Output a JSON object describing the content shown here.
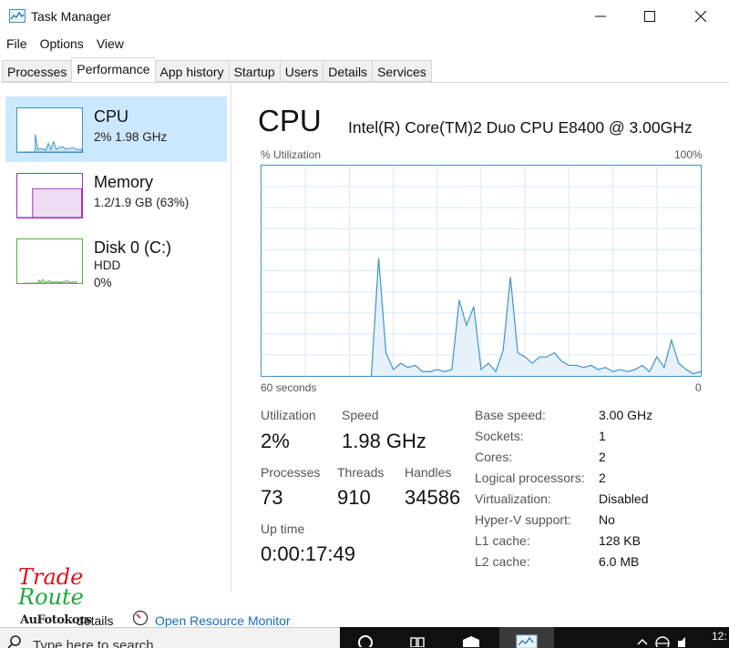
{
  "window": {
    "title": "Task Manager"
  },
  "menu": {
    "file": "File",
    "options": "Options",
    "view": "View"
  },
  "tabs": [
    "Processes",
    "Performance",
    "App history",
    "Startup",
    "Users",
    "Details",
    "Services"
  ],
  "active_tab": "Performance",
  "sidebar": {
    "items": [
      {
        "name": "CPU",
        "line1": "2%  1.98 GHz"
      },
      {
        "name": "Memory",
        "line1": "1.2/1.9 GB (63%)"
      },
      {
        "name": "Disk 0 (C:)",
        "line1": "HDD",
        "line2": "0%"
      }
    ]
  },
  "main": {
    "title": "CPU",
    "model": "Intel(R) Core(TM)2 Duo CPU E8400 @ 3.00GHz",
    "util_label": "% Utilization",
    "util_max": "100%",
    "time_left": "60 seconds",
    "time_right": "0"
  },
  "stats": {
    "utilization_label": "Utilization",
    "utilization_value": "2%",
    "speed_label": "Speed",
    "speed_value": "1.98 GHz",
    "processes_label": "Processes",
    "processes_value": "73",
    "threads_label": "Threads",
    "threads_value": "910",
    "handles_label": "Handles",
    "handles_value": "34586",
    "uptime_label": "Up time",
    "uptime_value": "0:00:17:49"
  },
  "specs": [
    {
      "label": "Base speed:",
      "value": "3.00 GHz"
    },
    {
      "label": "Sockets:",
      "value": "1"
    },
    {
      "label": "Cores:",
      "value": "2"
    },
    {
      "label": "Logical processors:",
      "value": "2"
    },
    {
      "label": "Virtualization:",
      "value": "Disabled"
    },
    {
      "label": "Hyper-V support:",
      "value": "No"
    },
    {
      "label": "L1 cache:",
      "value": "128 KB"
    },
    {
      "label": "L2 cache:",
      "value": "6.0 MB"
    }
  ],
  "footer": {
    "fewer_details": "details",
    "open_resource_monitor": "Open Resource Monitor"
  },
  "logo": {
    "line1": "Trade",
    "line2": "Route",
    "line3": "AuFotokors"
  },
  "taskbar": {
    "search_placeholder": "Type here to search",
    "time": "12:"
  },
  "colors": {
    "accent": "#3f93c9",
    "selected": "#cce8ff",
    "memory": "#9b30b8",
    "disk": "#4caf3a",
    "link": "#1a6bc4"
  },
  "chart_data": {
    "type": "area",
    "ylabel": "% Utilization",
    "ylim": [
      0,
      100
    ],
    "xlim": [
      60,
      0
    ],
    "x": [
      60,
      59,
      58,
      57,
      56,
      55,
      54,
      53,
      52,
      51,
      50,
      49,
      48,
      47,
      46,
      45,
      44,
      43,
      42,
      41,
      40,
      39,
      38,
      37,
      36,
      35,
      34,
      33,
      32,
      31,
      30,
      29,
      28,
      27,
      26,
      25,
      24,
      23,
      22,
      21,
      20,
      19,
      18,
      17,
      16,
      15,
      14,
      13,
      12,
      11,
      10,
      9,
      8,
      7,
      6,
      5,
      4,
      3,
      2,
      1,
      0
    ],
    "values": [
      0,
      0,
      0,
      0,
      0,
      0,
      0,
      0,
      0,
      0,
      0,
      0,
      0,
      0,
      0,
      0,
      56,
      11,
      3,
      6,
      4,
      5,
      2,
      2,
      3,
      2,
      3,
      36,
      24,
      33,
      3,
      6,
      2,
      12,
      47,
      11,
      9,
      6,
      9,
      9,
      11,
      7,
      5,
      5,
      4,
      5,
      3,
      4,
      2,
      3,
      2,
      3,
      5,
      2,
      9,
      4,
      17,
      6,
      3,
      1,
      2
    ],
    "grid": true
  }
}
